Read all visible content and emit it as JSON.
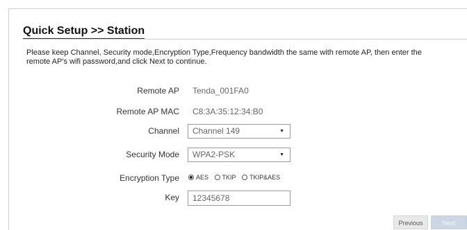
{
  "page": {
    "title": "Quick Setup >> Station",
    "description": "Please keep Channel, Security mode,Encryption Type,Frequency bandwidth the same with remote AP, then enter the remote AP's wifi password,and click Next to continue."
  },
  "form": {
    "remote_ap": {
      "label": "Remote AP",
      "value": "Tenda_001FA0"
    },
    "remote_ap_mac": {
      "label": "Remote AP MAC",
      "value": "C8:3A:35:12:34:B0"
    },
    "channel": {
      "label": "Channel",
      "value": "Channel 149"
    },
    "security_mode": {
      "label": "Security Mode",
      "value": "WPA2-PSK"
    },
    "encryption_type": {
      "label": "Encryption Type",
      "options": [
        "AES",
        "TKIP",
        "TKIP&AES"
      ],
      "selected": "AES"
    },
    "key": {
      "label": "Key",
      "value": "12345678"
    }
  },
  "buttons": {
    "previous": "Previous",
    "next": "Next"
  },
  "icons": {
    "select_caret": "caret-down-icon",
    "radio_selected": "radio-selected-icon",
    "radio_unselected": "radio-unselected-icon"
  }
}
